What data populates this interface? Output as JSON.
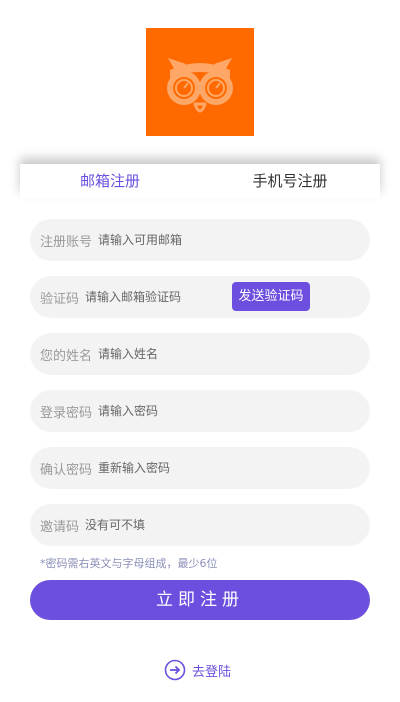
{
  "logo": {
    "icon": "owl-logo",
    "color": "#ff6a00"
  },
  "tabs": {
    "email": "邮箱注册",
    "phone": "手机号注册"
  },
  "form": {
    "account": {
      "label": "注册账号",
      "placeholder": "请输入可用邮箱"
    },
    "code": {
      "label": "验证码",
      "placeholder": "请输入邮箱验证码",
      "button": "发送验证码"
    },
    "name": {
      "label": "您的姓名",
      "placeholder": "请输入姓名"
    },
    "password": {
      "label": "登录密码",
      "placeholder": "请输入密码"
    },
    "confirm": {
      "label": "确认密码",
      "placeholder": "重新输入密码"
    },
    "invite": {
      "label": "邀请码",
      "placeholder": "没有可不填"
    }
  },
  "hint": "*密码需右英文与字母组成，最少6位",
  "submit": "立即注册",
  "login": {
    "label": "去登陆",
    "icon": "arrow-right-circle-icon"
  },
  "colors": {
    "accent": "#6c4fdf",
    "field_bg": "#f3f3f3"
  }
}
